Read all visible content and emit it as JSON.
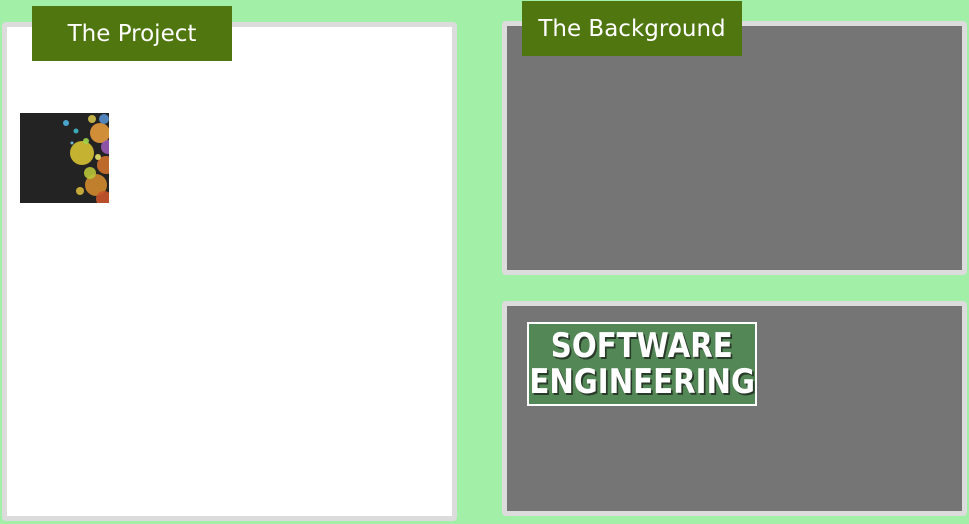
{
  "colors": {
    "page_background": "#a2f0a8",
    "tab_background": "#4f760f",
    "panel_border": "#dcdcdc",
    "gray_panel": "#747574",
    "badge_background": "#538856"
  },
  "tabs": {
    "project": "The Project",
    "background": "The Background"
  },
  "project_panel": {
    "thumbnail_icon": "bokeh-image"
  },
  "software_panel": {
    "badge_line_1": "SOFTWARE",
    "badge_line_2": "ENGINEERING"
  }
}
